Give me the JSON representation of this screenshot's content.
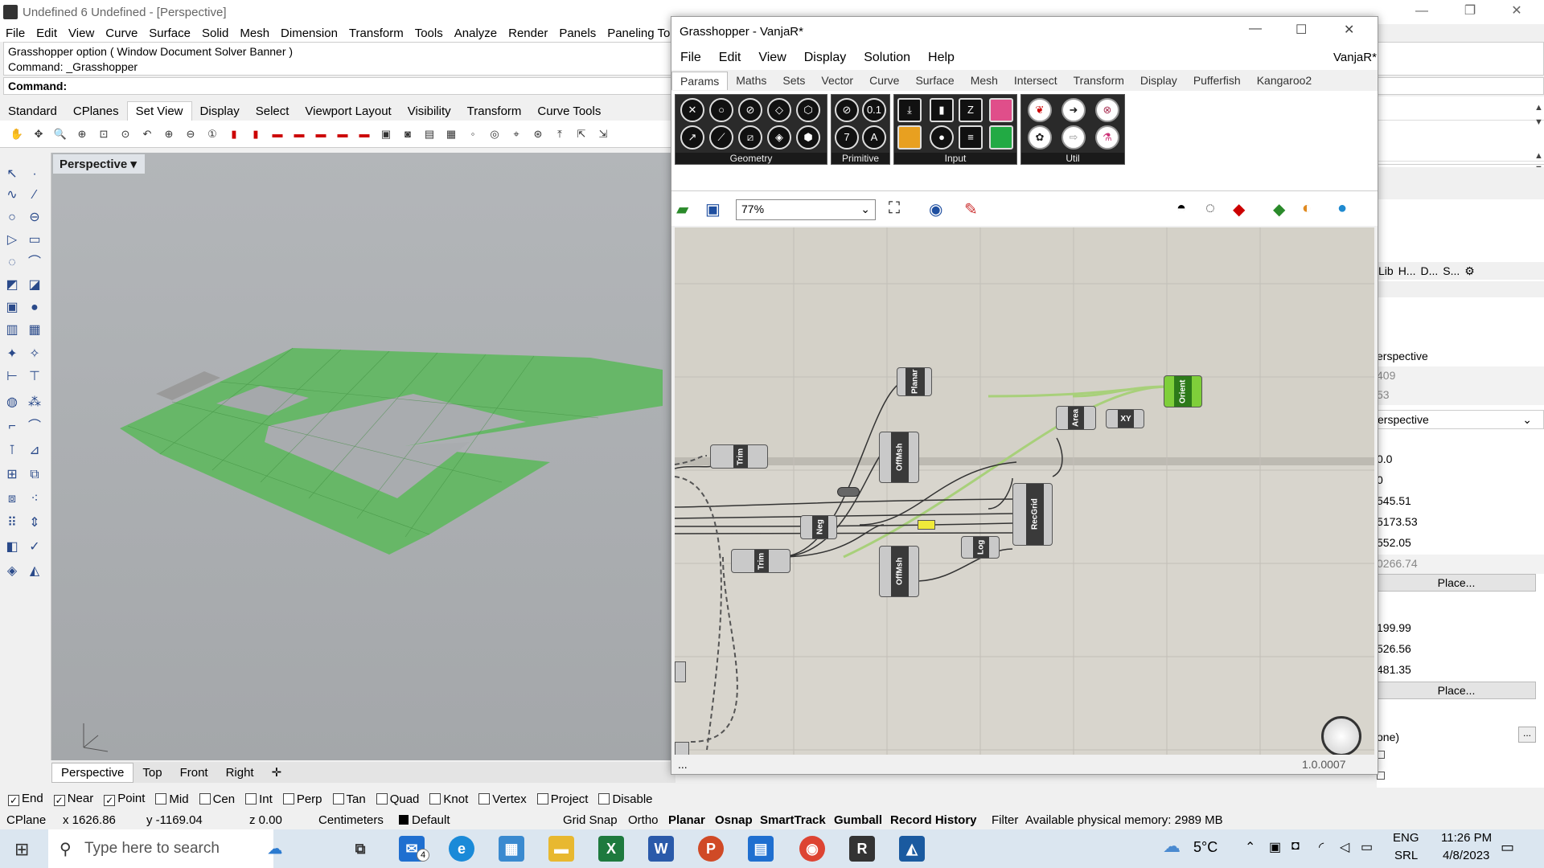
{
  "rhino": {
    "title": "Undefined 6 Undefined - [Perspective]",
    "menu": [
      "File",
      "Edit",
      "View",
      "Curve",
      "Surface",
      "Solid",
      "Mesh",
      "Dimension",
      "Transform",
      "Tools",
      "Analyze",
      "Render",
      "Panels",
      "Paneling Tools"
    ],
    "cmd_history": [
      "Grasshopper option ( Window  Document  Solver  Banner )",
      "Command: _Grasshopper"
    ],
    "cmd_prompt": "Command:",
    "toolbar_tabs": [
      "Standard",
      "CPlanes",
      "Set View",
      "Display",
      "Select",
      "Viewport Layout",
      "Visibility",
      "Transform",
      "Curve Tools"
    ],
    "viewport_label": "Perspective",
    "viewport_tabs": [
      "Perspective",
      "Top",
      "Front",
      "Right"
    ],
    "osnaps": [
      {
        "label": "End",
        "on": true
      },
      {
        "label": "Near",
        "on": true
      },
      {
        "label": "Point",
        "on": true
      },
      {
        "label": "Mid",
        "on": false
      },
      {
        "label": "Cen",
        "on": false
      },
      {
        "label": "Int",
        "on": false
      },
      {
        "label": "Perp",
        "on": false
      },
      {
        "label": "Tan",
        "on": false
      },
      {
        "label": "Quad",
        "on": false
      },
      {
        "label": "Knot",
        "on": false
      },
      {
        "label": "Vertex",
        "on": false
      },
      {
        "label": "Project",
        "on": false
      },
      {
        "label": "Disable",
        "on": false
      }
    ],
    "status": {
      "cplane": "CPlane",
      "x": "x 1626.86",
      "y": "y -1169.04",
      "z": "z 0.00",
      "units": "Centimeters",
      "layer": "Default",
      "toggles": [
        "Grid Snap",
        "Ortho",
        "Planar",
        "Osnap",
        "SmartTrack",
        "Gumball",
        "Record History",
        "Filter"
      ],
      "memory": "Available physical memory: 2989 MB"
    },
    "panel": {
      "tabs": [
        "Lib",
        "H...",
        "D...",
        "S..."
      ],
      "rows": [
        "erspective",
        "409",
        "53",
        "erspective",
        "0.0",
        "0",
        "545.51",
        "5173.53",
        "552.05",
        "0266.74",
        "199.99",
        "526.56",
        "481.35",
        "one)"
      ],
      "buttons": [
        "Place...",
        "Place..."
      ],
      "more": "..."
    }
  },
  "gh": {
    "title": "Grasshopper - VanjaR*",
    "doc": "VanjaR*",
    "menu": [
      "File",
      "Edit",
      "View",
      "Display",
      "Solution",
      "Help"
    ],
    "tabs": [
      "Params",
      "Maths",
      "Sets",
      "Vector",
      "Curve",
      "Surface",
      "Mesh",
      "Intersect",
      "Transform",
      "Display",
      "Pufferfish",
      "Kangaroo2"
    ],
    "groups": [
      "Geometry",
      "Primitive",
      "Input",
      "Util"
    ],
    "zoom": "77%",
    "status_left": "...",
    "version": "1.0.0007",
    "components": [
      "Planar",
      "Orient",
      "Area",
      "XY",
      "Trim",
      "OffMsh",
      "RecGrid",
      "Neg",
      "OffMsh",
      "Trim",
      "Log"
    ]
  },
  "taskbar": {
    "search": "Type here to search",
    "weather": "5°C",
    "lang": "ENG",
    "region": "SRL",
    "time": "11:26 PM",
    "date": "4/8/2023",
    "mail_badge": "4"
  }
}
